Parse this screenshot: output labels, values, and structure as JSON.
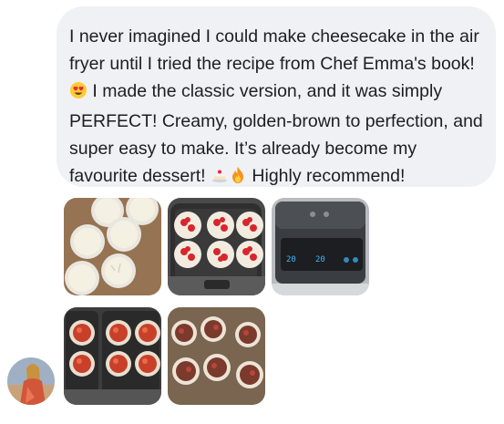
{
  "message": {
    "line1": "I never imagined I could make cheesecake in the air",
    "line2": "fryer until I tried the recipe from Chef Emma's book!",
    "line3": "I made the classic version, and it was simply",
    "line4": "PERFECT! Creamy, golden-brown to perfection, and",
    "line5": "super easy to make. It’s already become my",
    "line6a": "favourite dessert!",
    "line6b": "Highly recommend!",
    "emojis": [
      "heart-eyes-emoji",
      "cake-emoji",
      "fire-emoji"
    ]
  },
  "photos": [
    {
      "name": "photo-cheesecake-batter-cups",
      "subject": "cheesecake batter in cups"
    },
    {
      "name": "photo-strawberry-cheesecakes-basket",
      "subject": "strawberry topped cheesecakes in air fryer basket"
    },
    {
      "name": "photo-air-fryer-display",
      "subject": "air fryer digital display",
      "readout_left": "20",
      "readout_right": "20"
    },
    {
      "name": "photo-baked-cheesecakes-basket",
      "subject": "baked cheesecakes in air fryer"
    },
    {
      "name": "photo-baked-cheesecakes-table",
      "subject": "baked cheesecakes on table"
    }
  ],
  "colors": {
    "bubble_bg": "#eff1f4",
    "text": "#1c1e21"
  }
}
